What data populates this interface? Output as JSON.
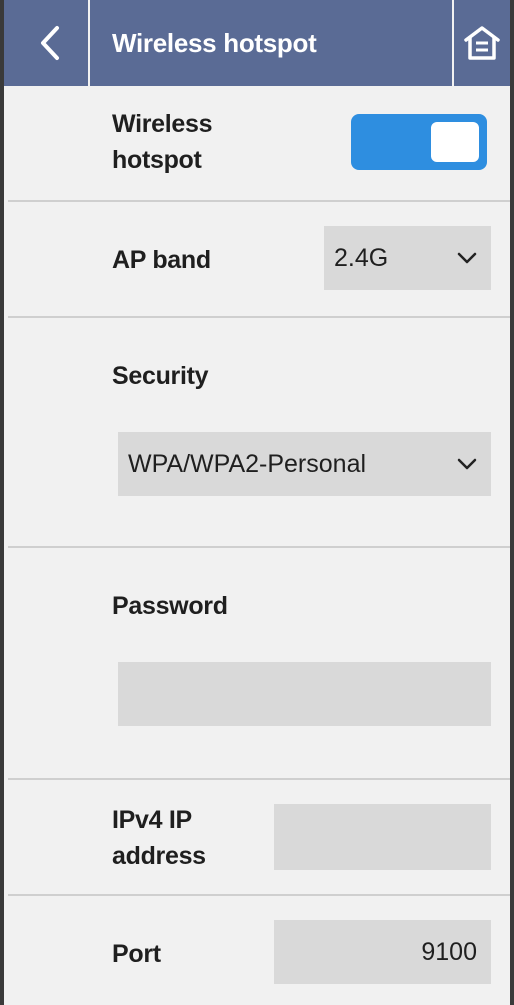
{
  "header": {
    "title": "Wireless hotspot",
    "back_icon": "chevron-left-icon",
    "home_icon": "home-icon",
    "color": "#5a6b95"
  },
  "hotspot": {
    "label_line1": "Wireless",
    "label_line2": "hotspot",
    "enabled": true,
    "toggle_color": "#2e8ee0"
  },
  "ap_band": {
    "label": "AP band",
    "value": "2.4G"
  },
  "security": {
    "label": "Security",
    "value": "WPA/WPA2-Personal"
  },
  "password": {
    "label": "Password",
    "value": ""
  },
  "ipv4": {
    "label_line1": "IPv4 IP",
    "label_line2": "address",
    "value": ""
  },
  "port": {
    "label": "Port",
    "value": "9100"
  }
}
